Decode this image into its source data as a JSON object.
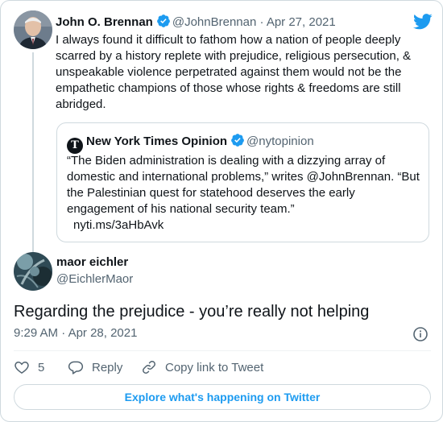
{
  "parent": {
    "author_name": "John O. Brennan",
    "author_handle": "@JohnBrennan",
    "separator": "·",
    "date": "Apr 27, 2021",
    "text": "I always found it difficult to fathom how a nation of people deeply scarred by a history replete with prejudice, religious persecution, & unspeakable violence perpetrated against them would not be the empathetic champions of those whose rights & freedoms are still abridged."
  },
  "quote": {
    "logo_letter": "T",
    "author_name": "New York Times Opinion",
    "author_handle": "@nytopinion",
    "text": "“The Biden administration is dealing with a dizzying array of domestic and international problems,” writes @JohnBrennan. “But the Palestinian quest for statehood deserves the early engagement of his national security team.”",
    "link": "nyti.ms/3aHbAvk"
  },
  "reply": {
    "author_name": "maor eichler",
    "author_handle": "@EichlerMaor",
    "text": "Regarding the prejudice - you’re really not helping",
    "time": "9:29 AM",
    "separator": "·",
    "date": "Apr 28, 2021"
  },
  "actions": {
    "like_count": "5",
    "reply_label": "Reply",
    "copy_link_label": "Copy link to Tweet"
  },
  "explore_label": "Explore what's happening on Twitter",
  "colors": {
    "accent": "#1d9bf0",
    "text": "#0f1419",
    "muted": "#536471",
    "border": "#cfd9de"
  },
  "icons": [
    "twitter-bird-icon",
    "verified-badge-icon",
    "info-icon",
    "heart-icon",
    "reply-icon",
    "link-icon"
  ]
}
